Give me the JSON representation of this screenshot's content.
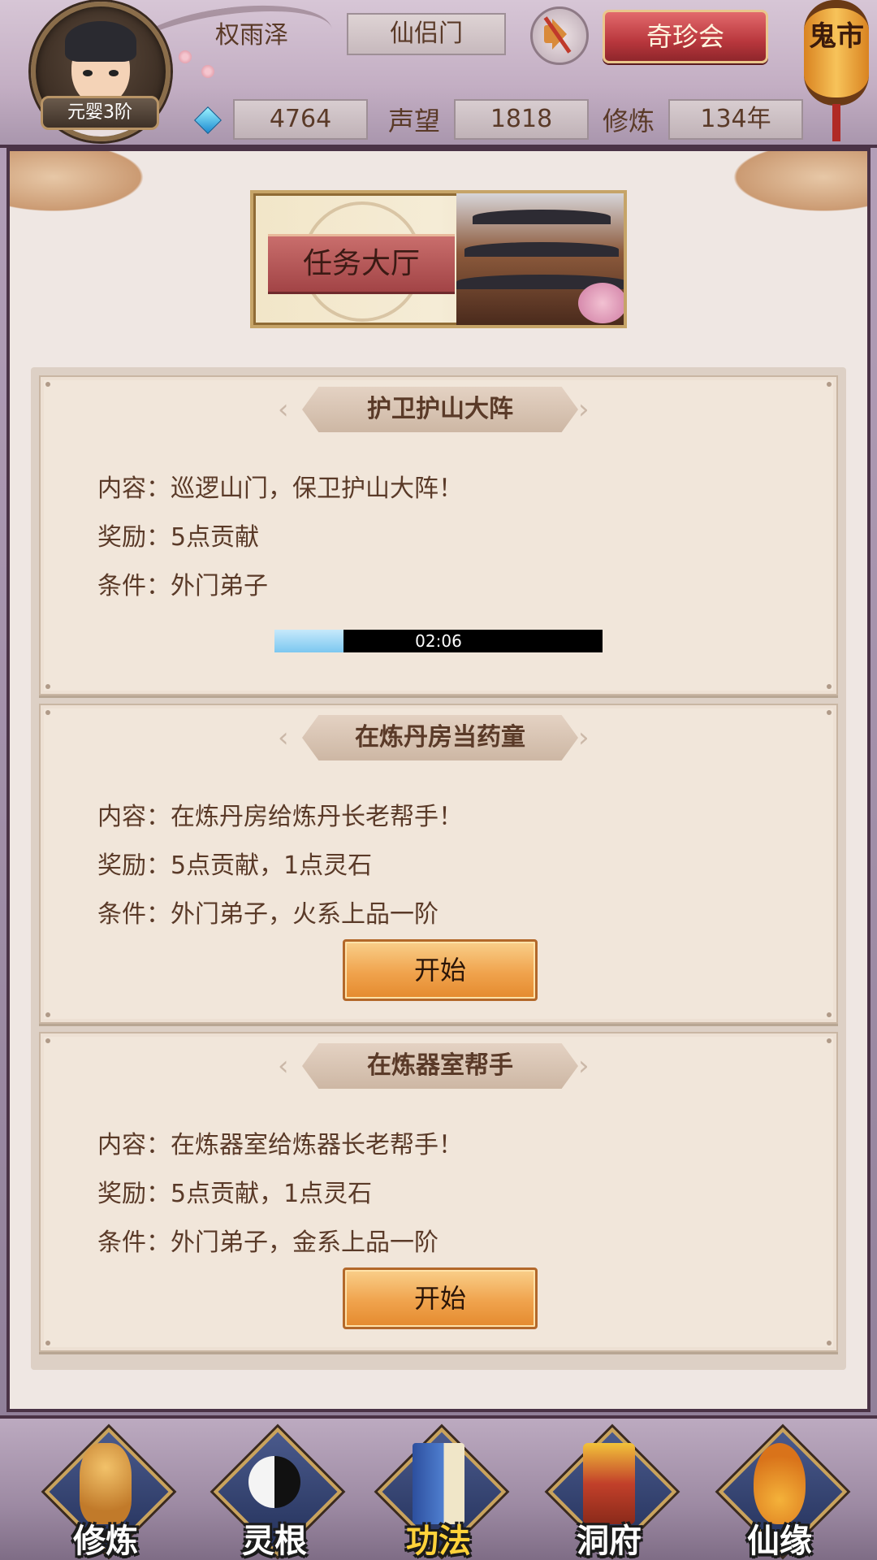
{
  "header": {
    "player_name": "权雨泽",
    "sect": "仙侣门",
    "rank": "元婴3阶",
    "treasure_button": "奇珍会",
    "ghost_market": "鬼市",
    "gems": "4764",
    "prestige_label": "声望",
    "prestige": "1818",
    "cultivation_label": "修炼",
    "cultivation": "134年"
  },
  "hall": {
    "title": "任务大厅"
  },
  "tasks": [
    {
      "title": "护卫护山大阵",
      "content": "内容：巡逻山门，保卫护山大阵！",
      "reward": "奖励：5点贡献",
      "condition": "条件：外门弟子",
      "progress_time": "02:06",
      "progress_fraction": 0.21
    },
    {
      "title": "在炼丹房当药童",
      "content": "内容：在炼丹房给炼丹长老帮手！",
      "reward": "奖励：5点贡献，1点灵石",
      "condition": "条件：外门弟子，火系上品一阶",
      "button": "开始"
    },
    {
      "title": "在炼器室帮手",
      "content": "内容：在炼器室给炼器长老帮手！",
      "reward": "奖励：5点贡献，1点灵石",
      "condition": "条件：外门弟子，金系上品一阶",
      "button": "开始"
    }
  ],
  "nav": [
    {
      "label": "修炼",
      "icon": "meditating-monk-icon",
      "active": false
    },
    {
      "label": "灵根",
      "icon": "yin-yang-sword-icon",
      "active": false
    },
    {
      "label": "功法",
      "icon": "scripture-book-icon",
      "active": true
    },
    {
      "label": "洞府",
      "icon": "pagoda-icon",
      "active": false
    },
    {
      "label": "仙缘",
      "icon": "gourd-icon",
      "active": false
    }
  ],
  "colors": {
    "text_brown": "#5a3a28",
    "button_orange": "#f0a34d",
    "treasure_red": "#b9373d",
    "active_nav": "#ffd23a"
  }
}
